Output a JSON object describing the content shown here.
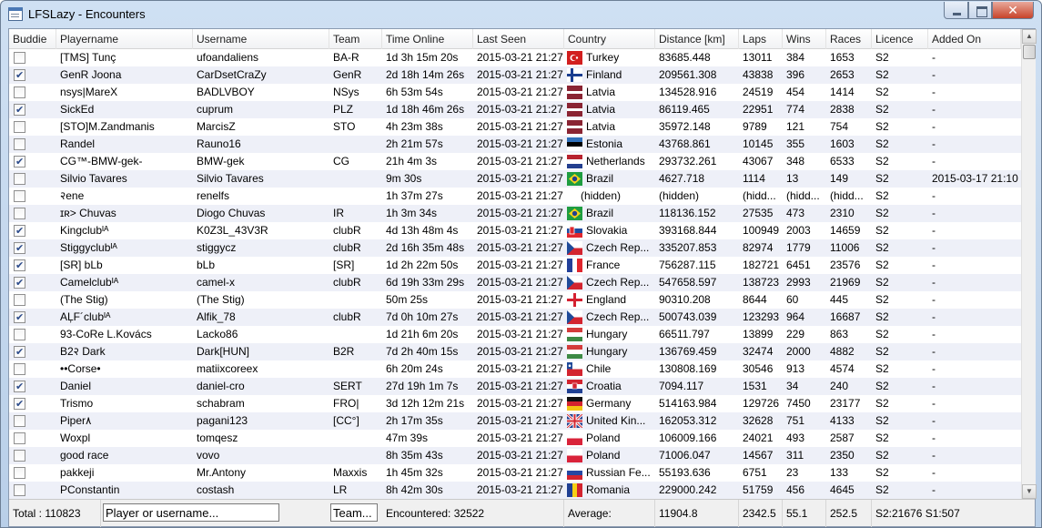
{
  "window": {
    "title": "LFSLazy - Encounters",
    "close_glyph": "✕"
  },
  "columns": [
    "Buddie",
    "Playername",
    "Username",
    "Team",
    "Time Online",
    "Last Seen",
    "Country",
    "Distance [km]",
    "Laps",
    "Wins",
    "Races",
    "Licence",
    "Added On"
  ],
  "rows": [
    {
      "buddy": false,
      "playername": "[TMS] Tunç",
      "username": "ufoandaliens",
      "team": "BA-R",
      "time_online": "1d 3h 15m 20s",
      "last_seen": "2015-03-21 21:27",
      "country": "Turkey",
      "distance": "83685.448",
      "laps": "13011",
      "wins": "384",
      "races": "1653",
      "licence": "S2",
      "added_on": "-"
    },
    {
      "buddy": true,
      "playername": "GenR Joona",
      "username": "CarDsetCraZy",
      "team": "GenR",
      "time_online": "2d 18h 14m 26s",
      "last_seen": "2015-03-21 21:27",
      "country": "Finland",
      "distance": "209561.308",
      "laps": "43838",
      "wins": "396",
      "races": "2653",
      "licence": "S2",
      "added_on": "-"
    },
    {
      "buddy": false,
      "playername": "nsys|MareX",
      "username": "BADLVBOY",
      "team": "NSys",
      "time_online": "6h 53m 54s",
      "last_seen": "2015-03-21 21:27",
      "country": "Latvia",
      "distance": "134528.916",
      "laps": "24519",
      "wins": "454",
      "races": "1414",
      "licence": "S2",
      "added_on": "-"
    },
    {
      "buddy": true,
      "playername": "SickEd",
      "username": "cuprum",
      "team": "PLZ",
      "time_online": "1d 18h 46m 26s",
      "last_seen": "2015-03-21 21:27",
      "country": "Latvia",
      "distance": "86119.465",
      "laps": "22951",
      "wins": "774",
      "races": "2838",
      "licence": "S2",
      "added_on": "-"
    },
    {
      "buddy": false,
      "playername": "[STO]M.Zandmanis",
      "username": "MarcisZ",
      "team": "STO",
      "time_online": "4h 23m 38s",
      "last_seen": "2015-03-21 21:27",
      "country": "Latvia",
      "distance": "35972.148",
      "laps": "9789",
      "wins": "121",
      "races": "754",
      "licence": "S2",
      "added_on": "-"
    },
    {
      "buddy": false,
      "playername": "Randel",
      "username": "Rauno16",
      "team": "",
      "time_online": "2h 21m 57s",
      "last_seen": "2015-03-21 21:27",
      "country": "Estonia",
      "distance": "43768.861",
      "laps": "10145",
      "wins": "355",
      "races": "1603",
      "licence": "S2",
      "added_on": "-"
    },
    {
      "buddy": true,
      "playername": "CG™-BMW-gek-",
      "username": "BMW-gek",
      "team": "CG",
      "time_online": "21h 4m 3s",
      "last_seen": "2015-03-21 21:27",
      "country": "Netherlands",
      "distance": "293732.261",
      "laps": "43067",
      "wins": "348",
      "races": "6533",
      "licence": "S2",
      "added_on": "-"
    },
    {
      "buddy": false,
      "playername": "Silvio Tavares",
      "username": "Silvio Tavares",
      "team": "",
      "time_online": "9m 30s",
      "last_seen": "2015-03-21 21:27",
      "country": "Brazil",
      "distance": "4627.718",
      "laps": "1114",
      "wins": "13",
      "races": "149",
      "licence": "S2",
      "added_on": "2015-03-17 21:10"
    },
    {
      "buddy": false,
      "playername": "२ene",
      "username": "renelfs",
      "team": "",
      "time_online": "1h 37m 27s",
      "last_seen": "2015-03-21 21:27",
      "country": "(hidden)",
      "distance": "(hidden)",
      "laps": "(hidd...",
      "wins": "(hidd...",
      "races": "(hidd...",
      "licence": "S2",
      "added_on": "-"
    },
    {
      "buddy": false,
      "playername": "ɪʀ> Chuvas",
      "username": "Diogo Chuvas",
      "team": "IR",
      "time_online": "1h 3m 34s",
      "last_seen": "2015-03-21 21:27",
      "country": "Brazil",
      "distance": "118136.152",
      "laps": "27535",
      "wins": "473",
      "races": "2310",
      "licence": "S2",
      "added_on": "-"
    },
    {
      "buddy": true,
      "playername": "Kingclubᴵᴬ",
      "username": "K0Z3L_43V3R",
      "team": "clubR",
      "time_online": "4d 13h 48m 4s",
      "last_seen": "2015-03-21 21:27",
      "country": "Slovakia",
      "distance": "393168.844",
      "laps": "100949",
      "wins": "2003",
      "races": "14659",
      "licence": "S2",
      "added_on": "-"
    },
    {
      "buddy": true,
      "playername": "Stiggyclubᴵᴬ",
      "username": "stiggycz",
      "team": "clubR",
      "time_online": "2d 16h 35m 48s",
      "last_seen": "2015-03-21 21:27",
      "country": "Czech Rep...",
      "distance": "335207.853",
      "laps": "82974",
      "wins": "1779",
      "races": "11006",
      "licence": "S2",
      "added_on": "-"
    },
    {
      "buddy": true,
      "playername": "[SR] bLb",
      "username": "bLb",
      "team": "[SR]",
      "time_online": "1d 2h 22m 50s",
      "last_seen": "2015-03-21 21:27",
      "country": "France",
      "distance": "756287.115",
      "laps": "182721",
      "wins": "6451",
      "races": "23576",
      "licence": "S2",
      "added_on": "-"
    },
    {
      "buddy": true,
      "playername": "Camelclubᴵᴬ",
      "username": "camel-x",
      "team": "clubR",
      "time_online": "6d 19h 33m 29s",
      "last_seen": "2015-03-21 21:27",
      "country": "Czech Rep...",
      "distance": "547658.597",
      "laps": "138723",
      "wins": "2993",
      "races": "21969",
      "licence": "S2",
      "added_on": "-"
    },
    {
      "buddy": false,
      "playername": "(The Stig)",
      "username": "(The Stig)",
      "team": "",
      "time_online": "50m 25s",
      "last_seen": "2015-03-21 21:27",
      "country": "England",
      "distance": "90310.208",
      "laps": "8644",
      "wins": "60",
      "races": "445",
      "licence": "S2",
      "added_on": "-"
    },
    {
      "buddy": true,
      "playername": "ΑĻF´clubᴵᴬ",
      "username": "Alfik_78",
      "team": "clubR",
      "time_online": "7d 0h 10m 27s",
      "last_seen": "2015-03-21 21:27",
      "country": "Czech Rep...",
      "distance": "500743.039",
      "laps": "123293",
      "wins": "964",
      "races": "16687",
      "licence": "S2",
      "added_on": "-"
    },
    {
      "buddy": false,
      "playername": "93-CoRe L.Kovács",
      "username": "Lacko86",
      "team": "",
      "time_online": "1d 21h 6m 20s",
      "last_seen": "2015-03-21 21:27",
      "country": "Hungary",
      "distance": "66511.797",
      "laps": "13899",
      "wins": "229",
      "races": "863",
      "licence": "S2",
      "added_on": "-"
    },
    {
      "buddy": true,
      "playername": "B2२ Dark",
      "username": "Dark[HUN]",
      "team": "B2R",
      "time_online": "7d 2h 40m 15s",
      "last_seen": "2015-03-21 21:27",
      "country": "Hungary",
      "distance": "136769.459",
      "laps": "32474",
      "wins": "2000",
      "races": "4882",
      "licence": "S2",
      "added_on": "-"
    },
    {
      "buddy": false,
      "playername": "••Corse•",
      "username": "matiixcoreex",
      "team": "",
      "time_online": "6h 20m 24s",
      "last_seen": "2015-03-21 21:27",
      "country": "Chile",
      "distance": "130808.169",
      "laps": "30546",
      "wins": "913",
      "races": "4574",
      "licence": "S2",
      "added_on": "-"
    },
    {
      "buddy": true,
      "playername": "Daniel",
      "username": "daniel-cro",
      "team": "SERT",
      "time_online": "27d 19h 1m 7s",
      "last_seen": "2015-03-21 21:27",
      "country": "Croatia",
      "distance": "7094.117",
      "laps": "1531",
      "wins": "34",
      "races": "240",
      "licence": "S2",
      "added_on": "-"
    },
    {
      "buddy": true,
      "playername": "Trismo",
      "username": "schabram",
      "team": "FRO|",
      "time_online": "3d 12h 12m 21s",
      "last_seen": "2015-03-21 21:27",
      "country": "Germany",
      "distance": "514163.984",
      "laps": "129726",
      "wins": "7450",
      "races": "23177",
      "licence": "S2",
      "added_on": "-"
    },
    {
      "buddy": false,
      "playername": "Piper٨",
      "username": "pagani123",
      "team": "[CC°]",
      "time_online": "2h 17m 35s",
      "last_seen": "2015-03-21 21:27",
      "country": "United Kin...",
      "distance": "162053.312",
      "laps": "32628",
      "wins": "751",
      "races": "4133",
      "licence": "S2",
      "added_on": "-"
    },
    {
      "buddy": false,
      "playername": "Woxpl",
      "username": "tomqesz",
      "team": "",
      "time_online": "47m 39s",
      "last_seen": "2015-03-21 21:27",
      "country": "Poland",
      "distance": "106009.166",
      "laps": "24021",
      "wins": "493",
      "races": "2587",
      "licence": "S2",
      "added_on": "-"
    },
    {
      "buddy": false,
      "playername": "good race",
      "username": "vovo",
      "team": "",
      "time_online": "8h 35m 43s",
      "last_seen": "2015-03-21 21:27",
      "country": "Poland",
      "distance": "71006.047",
      "laps": "14567",
      "wins": "311",
      "races": "2350",
      "licence": "S2",
      "added_on": "-"
    },
    {
      "buddy": false,
      "playername": "pakkeji",
      "username": "Mr.Antony",
      "team": "Maxxis",
      "time_online": "1h 45m 32s",
      "last_seen": "2015-03-21 21:27",
      "country": "Russian Fe...",
      "distance": "55193.636",
      "laps": "6751",
      "wins": "23",
      "races": "133",
      "licence": "S2",
      "added_on": "-"
    },
    {
      "buddy": false,
      "playername": "PConstantin",
      "username": "costash",
      "team": "LR",
      "time_online": "8h 42m 30s",
      "last_seen": "2015-03-21 21:27",
      "country": "Romania",
      "distance": "229000.242",
      "laps": "51759",
      "wins": "456",
      "races": "4645",
      "licence": "S2",
      "added_on": "-"
    }
  ],
  "flags": {
    "Turkey": "turkey-flag-icon",
    "Finland": "finland-flag-icon",
    "Latvia": "latvia-flag-icon",
    "Estonia": "estonia-flag-icon",
    "Netherlands": "netherlands-flag-icon",
    "Brazil": "brazil-flag-icon",
    "Slovakia": "slovakia-flag-icon",
    "Czech Rep...": "czech-flag-icon",
    "France": "france-flag-icon",
    "England": "england-flag-icon",
    "Hungary": "hungary-flag-icon",
    "Chile": "chile-flag-icon",
    "Croatia": "croatia-flag-icon",
    "Germany": "germany-flag-icon",
    "United Kin...": "uk-flag-icon",
    "Poland": "poland-flag-icon",
    "Russian Fe...": "russia-flag-icon",
    "Romania": "romania-flag-icon"
  },
  "footer": {
    "total": "Total : 110823",
    "player_filter_placeholder": "Player or username...",
    "team_filter_placeholder": "Team...",
    "encountered": "Encountered: 32522",
    "average_label": "Average:",
    "avg_distance": "11904.8",
    "avg_laps": "2342.5",
    "avg_wins": "55.1",
    "avg_races": "252.5",
    "licence_summary": "S2:21676 S1:507"
  },
  "colors": {
    "alt_row": "#eef0f8",
    "checkmark": "#2b4a8a",
    "title_bar": "#cfe0f3"
  }
}
